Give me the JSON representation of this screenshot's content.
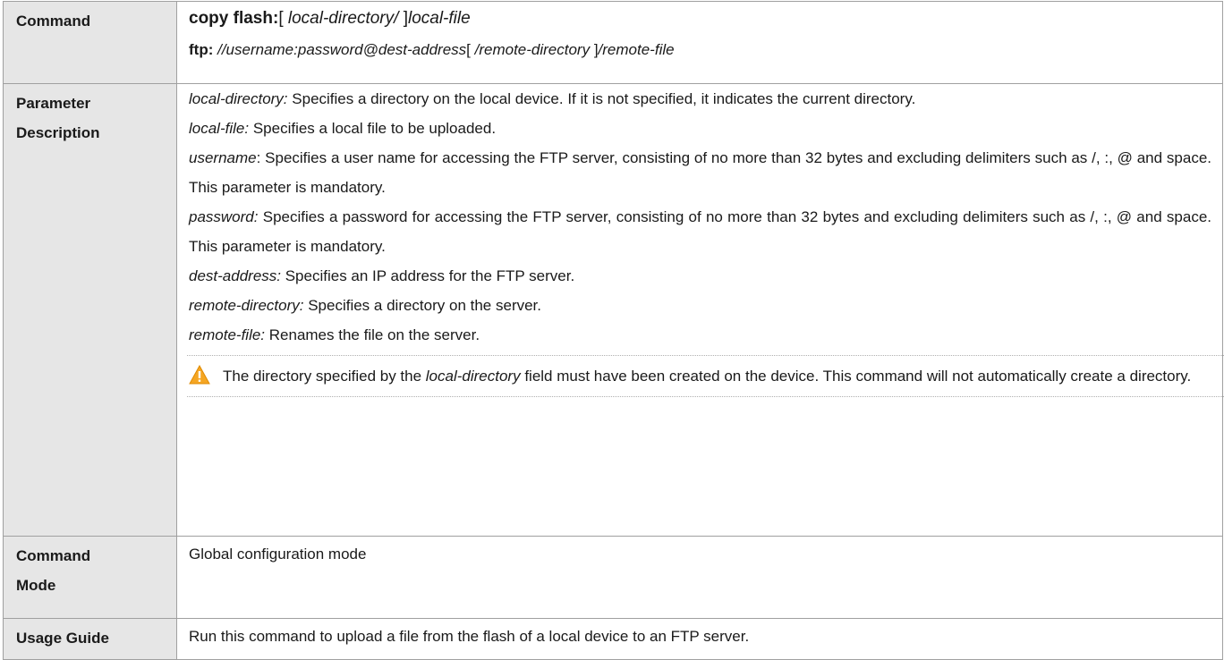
{
  "table": {
    "command": {
      "label": "Command",
      "line1": {
        "keyword": "copy flash:",
        "open_bracket": "[ ",
        "local_directory": "local-directory/ ",
        "close_bracket": "]",
        "local_file": "local-file"
      },
      "line2": {
        "keyword": "ftp:",
        "url": " //username:password@dest-address",
        "open_bracket": "[ ",
        "remote_directory": "/remote-directory ",
        "close_bracket": "]",
        "remote_file": "/remote-file"
      }
    },
    "parameter": {
      "label_line1": "Parameter",
      "label_line2": "Description",
      "items": [
        {
          "term": "local-directory:",
          "desc": " Specifies a directory on the local device. If it is not specified, it indicates the current directory."
        },
        {
          "term": "local-file:",
          "desc": " Specifies a local file to be uploaded."
        },
        {
          "term": "username",
          "desc": ": Specifies a user name for accessing the FTP server, consisting of no more than 32 bytes and excluding delimiters such as /, :, @ and space. This parameter is mandatory."
        },
        {
          "term": "password:",
          "desc": " Specifies a password for accessing the FTP server, consisting of no more than 32 bytes and excluding delimiters such as /, :, @ and space. This parameter is mandatory."
        },
        {
          "term": "dest-address:",
          "desc": " Specifies an IP address for the FTP server."
        },
        {
          "term": "remote-directory:",
          "desc": " Specifies a directory on the server."
        },
        {
          "term": "remote-file:",
          "desc": " Renames the file on the server."
        }
      ],
      "note": {
        "icon": "warning-triangle-icon",
        "text_before": "The directory specified by the ",
        "field": "local-directory",
        "text_after": " field must have been created on the device. This command will not automatically create a directory."
      }
    },
    "mode": {
      "label_line1": "Command",
      "label_line2": "Mode",
      "value": "Global configuration mode"
    },
    "usage": {
      "label": "Usage Guide",
      "value": "Run this command to upload a file from the flash of a local device to an FTP server."
    }
  },
  "colors": {
    "label_background": "#e6e6e6",
    "border": "#a0a0a0",
    "warning_icon": "#f5a623"
  }
}
